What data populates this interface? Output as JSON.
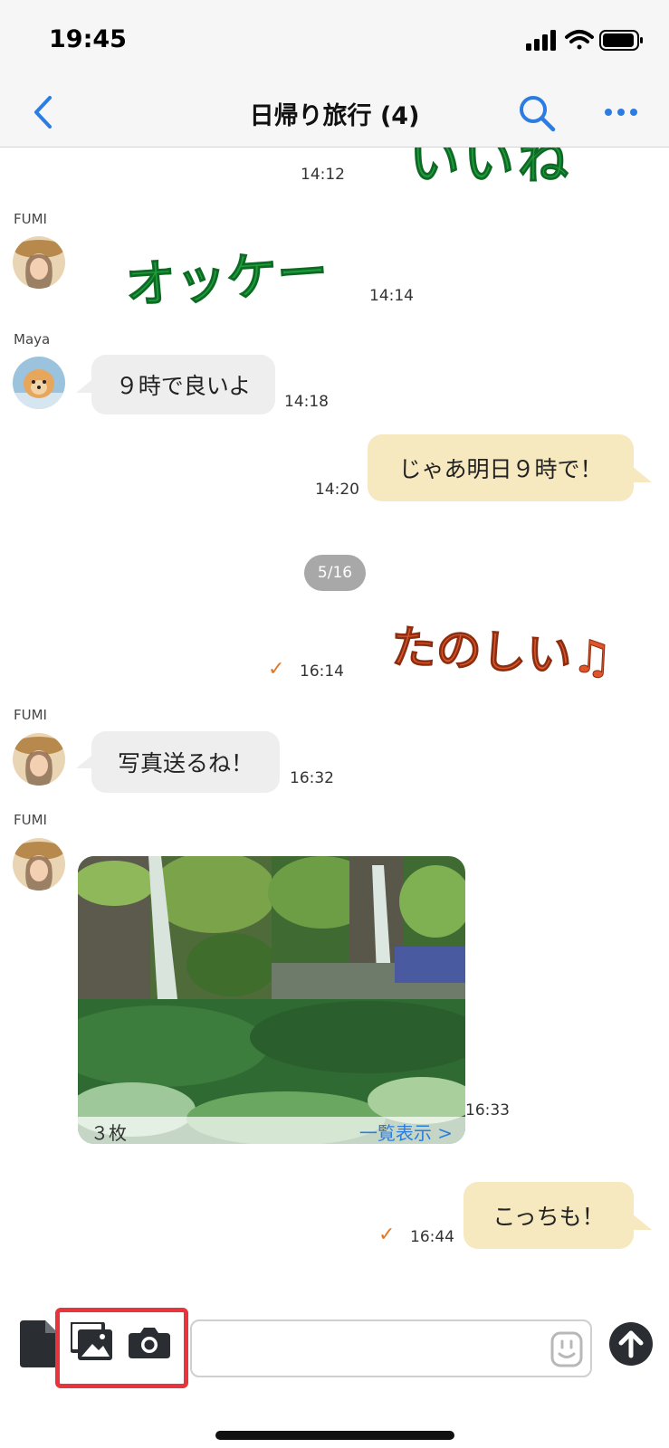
{
  "status_bar": {
    "time": "19:45"
  },
  "header": {
    "title": "日帰り旅行 (4)"
  },
  "messages": [
    {
      "kind": "sticker_out",
      "text": "いいね",
      "time": "14:12",
      "color": "#1f9d3a"
    },
    {
      "kind": "sticker_in",
      "sender": "FUMI",
      "text": "オッケー",
      "time": "14:14",
      "color": "#1f9d3a"
    },
    {
      "kind": "text_in",
      "sender": "Maya",
      "text": "９時で良いよ",
      "time": "14:18"
    },
    {
      "kind": "text_out",
      "text": "じゃあ明日９時で！",
      "time": "14:20"
    },
    {
      "kind": "date_divider",
      "text": "5/16"
    },
    {
      "kind": "sticker_out",
      "text": "たのしい♫",
      "time": "16:14",
      "read": true,
      "color": "#e0552a"
    },
    {
      "kind": "text_in",
      "sender": "FUMI",
      "text": "写真送るね！",
      "time": "16:32"
    },
    {
      "kind": "photos_in",
      "sender": "FUMI",
      "count_label": "３枚",
      "view_all": "一覧表示 >",
      "time": "16:33"
    },
    {
      "kind": "text_out",
      "text": "こっちも！",
      "time": "16:44",
      "read": true
    }
  ],
  "toolbar": {
    "input_placeholder": ""
  },
  "colors": {
    "accent": "#2b7de1",
    "highlight": "#e8343d",
    "out_bubble": "#f6e8bf",
    "in_bubble": "#eeeeef"
  }
}
